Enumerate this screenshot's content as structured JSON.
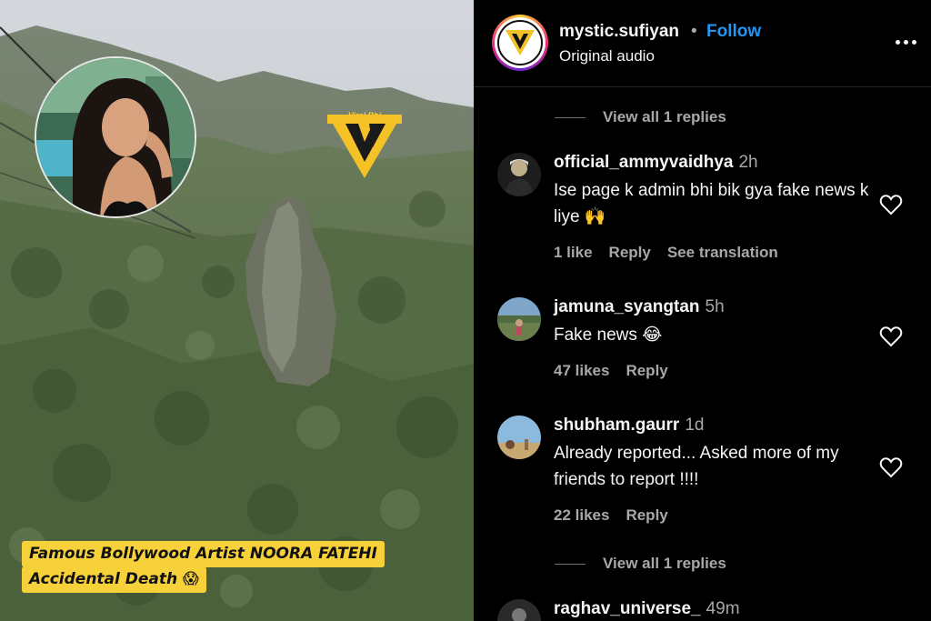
{
  "post": {
    "watermark_text": "Viral Bhi",
    "caption_line1": "Famous Bollywood Artist NOORA FATEHI",
    "caption_line2": "Accidental Death",
    "caption_emoji": "😱"
  },
  "header": {
    "username": "mystic.sufiyan",
    "separator": "•",
    "follow_label": "Follow",
    "audio_label": "Original audio",
    "more_icon": "more-horizontal-icon"
  },
  "replies_top": {
    "label": "View all 1 replies"
  },
  "comments": [
    {
      "username": "official_ammyvaidhya",
      "time": "2h",
      "text": "Ise page k admin bhi bik gya fake news k liye 🙌",
      "likes": "1 like",
      "reply": "Reply",
      "translate": "See translation"
    },
    {
      "username": "jamuna_syangtan",
      "time": "5h",
      "text": "Fake news 😂",
      "likes": "47 likes",
      "reply": "Reply"
    },
    {
      "username": "shubham.gaurr",
      "time": "1d",
      "text": "Already reported... Asked more of my friends to report !!!!",
      "likes": "22 likes",
      "reply": "Reply"
    },
    {
      "username": "raghav_universe_",
      "time": "49m"
    }
  ],
  "replies_bottom": {
    "label": "View all 1 replies"
  },
  "colors": {
    "follow": "#2196f3",
    "caption_bg": "#f7d13a",
    "panel_bg": "#000000",
    "secondary_text": "#a8a8a8"
  }
}
